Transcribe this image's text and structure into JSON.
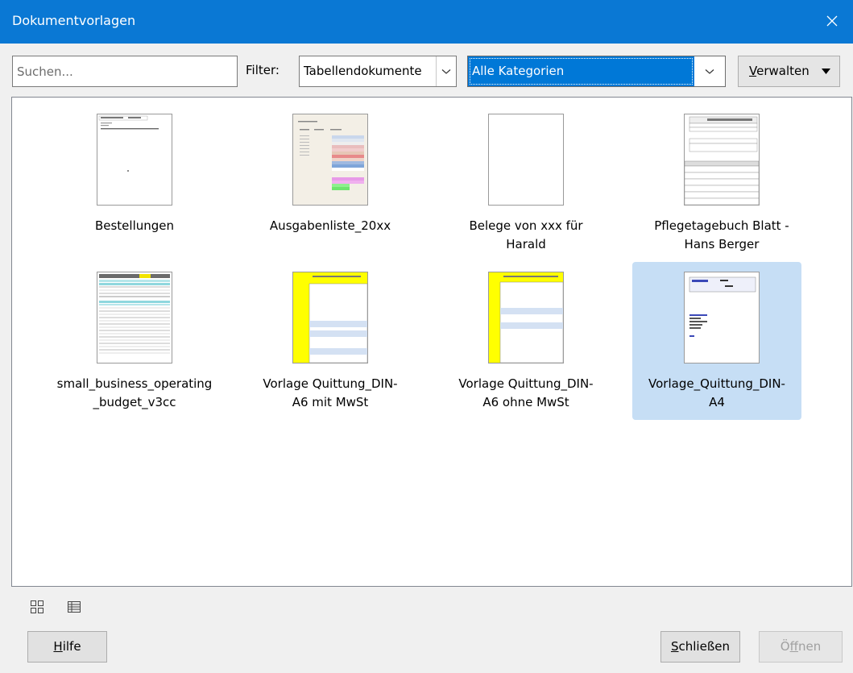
{
  "window": {
    "title": "Dokumentvorlagen"
  },
  "toolbar": {
    "search_placeholder": "Suchen...",
    "filter_label": "Filter:",
    "type_value": "Tabellendokumente",
    "category_value": "Alle Kategorien",
    "manage_accel": "V",
    "manage_rest": "erwalten"
  },
  "templates": [
    {
      "line1": "Bestellungen",
      "line2": ""
    },
    {
      "line1": "Ausgabenliste_20xx",
      "line2": ""
    },
    {
      "line1": "Belege von xxx für",
      "line2": "Harald"
    },
    {
      "line1": "Pflegetagebuch Blatt -",
      "line2": "Hans Berger"
    },
    {
      "line1": "small_business_operating",
      "line2": "_budget_v3cc"
    },
    {
      "line1": "Vorlage Quittung_DIN-",
      "line2": "A6 mit MwSt"
    },
    {
      "line1": "Vorlage Quittung_DIN-",
      "line2": "A6 ohne MwSt"
    },
    {
      "line1": "Vorlage_Quittung_DIN-",
      "line2": "A4",
      "selected": true
    }
  ],
  "footer": {
    "help_accel": "H",
    "help_rest": "ilfe",
    "close_accel": "S",
    "close_rest": "chließen",
    "open_pre": "Ö",
    "open_accel": "f",
    "open_rest": "fnen"
  },
  "colors": {
    "titlebar": "#0a78d4",
    "selection": "#c6def5",
    "accent": "#0078d7"
  },
  "icons": {
    "thumbnail_view": "grid-view-icon",
    "list_view": "list-view-icon",
    "close": "close-icon"
  }
}
